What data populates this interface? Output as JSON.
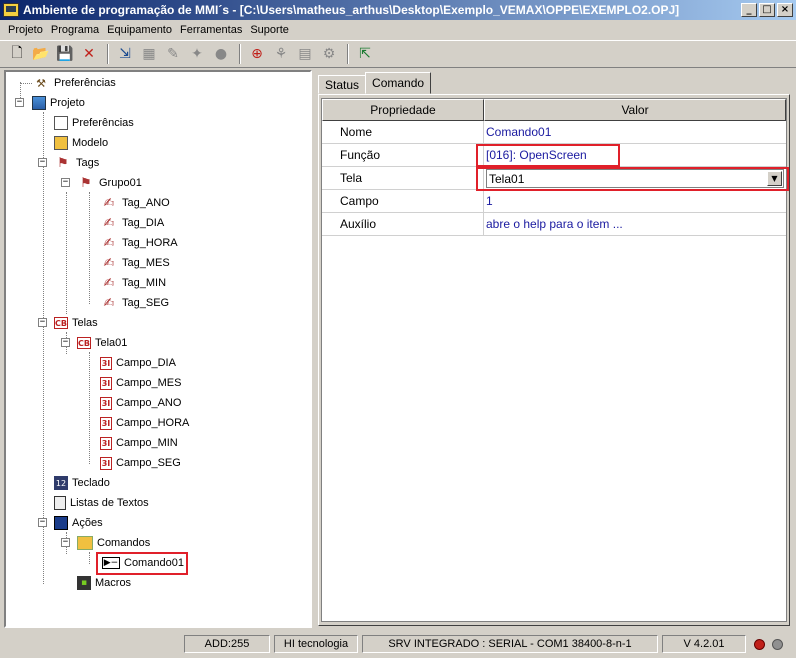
{
  "window": {
    "title": "Ambiente de programação de MMI´s - [C:\\Users\\matheus_arthus\\Desktop\\Exemplo_VEMAX\\OPPE\\EXEMPLO2.OPJ]",
    "minimize": "_",
    "maximize": "□",
    "close": "×"
  },
  "menu": [
    "Projeto",
    "Programa",
    "Equipamento",
    "Ferramentas",
    "Suporte"
  ],
  "toolbar_icons": [
    "new-icon",
    "open-icon",
    "save-icon",
    "delete-icon",
    "compile-icon",
    "transfer-icon",
    "debug-icon",
    "run-icon",
    "connect-icon",
    "network-icon",
    "monitor-icon",
    "settings-icon",
    "exit-icon"
  ],
  "tree": {
    "items": [
      {
        "label": "Preferências"
      },
      {
        "label": "Projeto"
      },
      {
        "label": "Preferências"
      },
      {
        "label": "Modelo"
      },
      {
        "label": "Tags"
      },
      {
        "label": "Grupo01"
      },
      {
        "label": "Tag_ANO"
      },
      {
        "label": "Tag_DIA"
      },
      {
        "label": "Tag_HORA"
      },
      {
        "label": "Tag_MES"
      },
      {
        "label": "Tag_MIN"
      },
      {
        "label": "Tag_SEG"
      },
      {
        "label": "Telas"
      },
      {
        "label": "Tela01"
      },
      {
        "label": "Campo_DIA"
      },
      {
        "label": "Campo_MES"
      },
      {
        "label": "Campo_ANO"
      },
      {
        "label": "Campo_HORA"
      },
      {
        "label": "Campo_MIN"
      },
      {
        "label": "Campo_SEG"
      },
      {
        "label": "Teclado"
      },
      {
        "label": "Listas de Textos"
      },
      {
        "label": "Ações"
      },
      {
        "label": "Comandos"
      },
      {
        "label": "Comando01"
      },
      {
        "label": "Macros"
      }
    ],
    "icon_text": {
      "tela": "CB",
      "campo": "3I",
      "calc": "12"
    }
  },
  "tabs": [
    {
      "label": "Status"
    },
    {
      "label": "Comando"
    }
  ],
  "grid": {
    "headers": [
      "Propriedade",
      "Valor"
    ],
    "rows": [
      {
        "name": "Nome",
        "value": "Comando01"
      },
      {
        "name": "Função",
        "value": "[016]: OpenScreen"
      },
      {
        "name": "Tela",
        "value": "Tela01"
      },
      {
        "name": "Campo",
        "value": "1"
      },
      {
        "name": "Auxílio",
        "value": "abre o help para o item ..."
      }
    ],
    "combo_arrow": "▼"
  },
  "status": {
    "add": "ADD:255",
    "company": "HI tecnologia",
    "connection": "SRV INTEGRADO : SERIAL - COM1 38400-8-n-1",
    "version": "V 4.2.01"
  },
  "colors": {
    "highlight": "#e0202a",
    "led_red": "#c0201a",
    "led_gray": "#909090",
    "value_text": "#1a1aa0"
  }
}
